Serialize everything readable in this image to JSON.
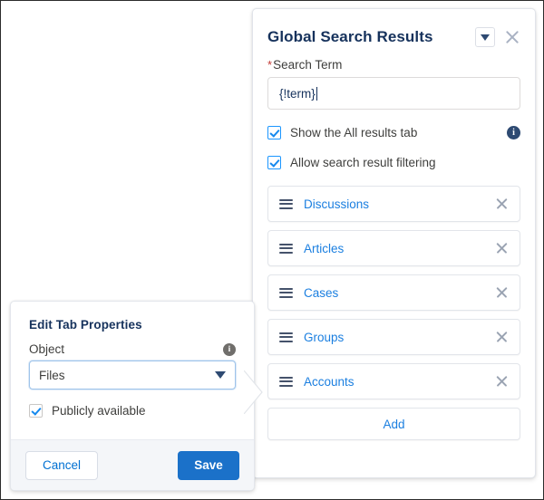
{
  "left_panel": {
    "title": "Edit Tab Properties",
    "object_field": {
      "label": "Object",
      "value": "Files",
      "info_icon": "info-icon"
    },
    "publicly_available": {
      "label": "Publicly available",
      "checked": true
    },
    "footer": {
      "cancel_label": "Cancel",
      "save_label": "Save"
    }
  },
  "right_panel": {
    "title": "Global Search Results",
    "header_icons": {
      "dropdown": "chevron-down-icon",
      "close": "close-icon"
    },
    "search_term": {
      "label": "Search Term",
      "required_marker": "*",
      "value": "{!term}"
    },
    "options": [
      {
        "label": "Show the All results tab",
        "checked": true,
        "info_icon": "info-icon"
      },
      {
        "label": "Allow search result filtering",
        "checked": true,
        "info_icon": null
      }
    ],
    "result_tabs": [
      {
        "label": "Discussions",
        "drag_icon": "drag-handle-icon",
        "remove_icon": "close-icon"
      },
      {
        "label": "Articles",
        "drag_icon": "drag-handle-icon",
        "remove_icon": "close-icon"
      },
      {
        "label": "Cases",
        "drag_icon": "drag-handle-icon",
        "remove_icon": "close-icon"
      },
      {
        "label": "Groups",
        "drag_icon": "drag-handle-icon",
        "remove_icon": "close-icon"
      },
      {
        "label": "Accounts",
        "drag_icon": "drag-handle-icon",
        "remove_icon": "close-icon"
      }
    ],
    "add_label": "Add"
  },
  "colors": {
    "brand_blue": "#1b71c9",
    "link_blue": "#1b7fe0",
    "title_navy": "#16325c",
    "required_red": "#c23934",
    "footer_gray": "#f4f6f9"
  }
}
